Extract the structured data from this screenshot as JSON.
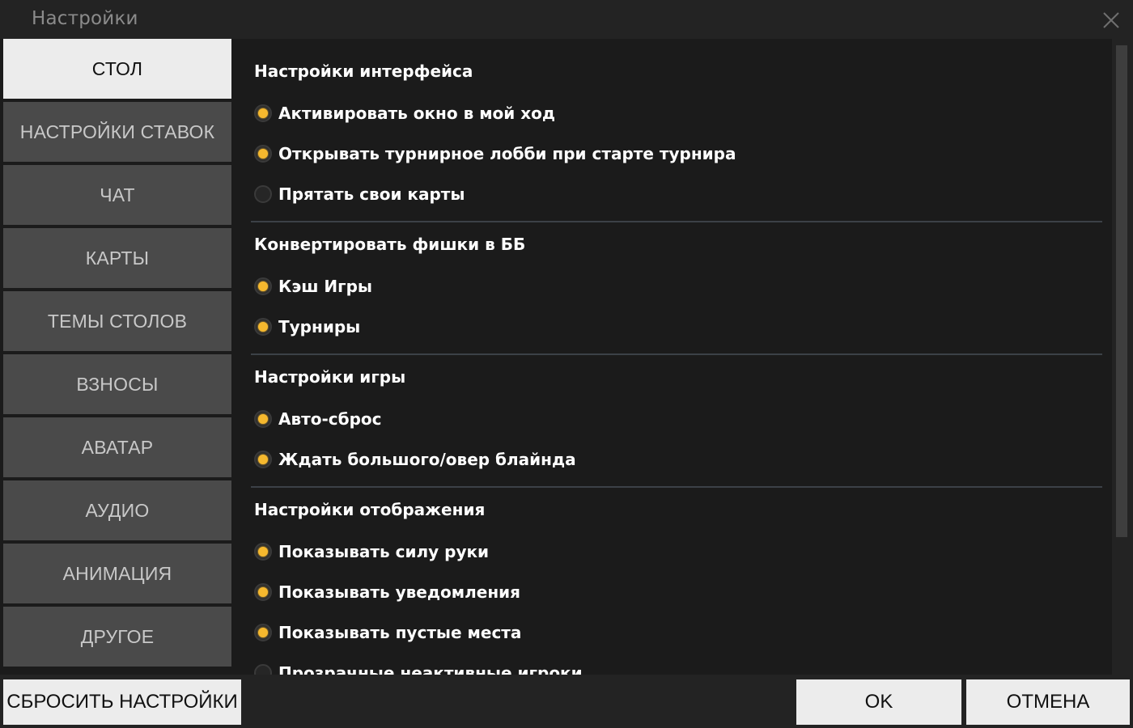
{
  "window": {
    "title": "Настройки"
  },
  "sidebar": {
    "items": [
      {
        "label": "СТОЛ",
        "active": true
      },
      {
        "label": "НАСТРОЙКИ СТАВОК",
        "active": false
      },
      {
        "label": "ЧАТ",
        "active": false
      },
      {
        "label": "КАРТЫ",
        "active": false
      },
      {
        "label": "ТЕМЫ СТОЛОВ",
        "active": false
      },
      {
        "label": "ВЗНОСЫ",
        "active": false
      },
      {
        "label": "АВАТАР",
        "active": false
      },
      {
        "label": "АУДИО",
        "active": false
      },
      {
        "label": "АНИМАЦИЯ",
        "active": false
      },
      {
        "label": "ДРУГОЕ",
        "active": false
      }
    ]
  },
  "sections": [
    {
      "title": "Настройки интерфейса",
      "options": [
        {
          "label": "Активировать окно в мой ход",
          "checked": true
        },
        {
          "label": "Открывать турнирное лобби при старте турнира",
          "checked": true
        },
        {
          "label": "Прятать свои карты",
          "checked": false
        }
      ]
    },
    {
      "title": "Конвертировать фишки в ББ",
      "options": [
        {
          "label": "Кэш Игры",
          "checked": true
        },
        {
          "label": "Турниры",
          "checked": true
        }
      ]
    },
    {
      "title": "Настройки игры",
      "options": [
        {
          "label": "Авто-сброс",
          "checked": true
        },
        {
          "label": "Ждать большого/овер блайнда",
          "checked": true
        }
      ]
    },
    {
      "title": "Настройки отображения",
      "options": [
        {
          "label": "Показывать силу руки",
          "checked": true
        },
        {
          "label": "Показывать уведомления",
          "checked": true
        },
        {
          "label": "Показывать пустые места",
          "checked": true
        },
        {
          "label": "Прозрачные неактивные игроки",
          "checked": false
        }
      ]
    }
  ],
  "footer": {
    "reset_label": "СБРОСИТЬ НАСТРОЙКИ",
    "ok_label": "OK",
    "cancel_label": "ОТМЕНА"
  },
  "colors": {
    "accent": "#f5b82e",
    "active_tab_bg": "#ececec",
    "tab_bg": "#4a4a4a",
    "panel_bg": "#1b1b1b"
  },
  "icons": {
    "close": "close-icon",
    "radio_on": "radio-checked-icon",
    "radio_off": "radio-unchecked-icon"
  }
}
